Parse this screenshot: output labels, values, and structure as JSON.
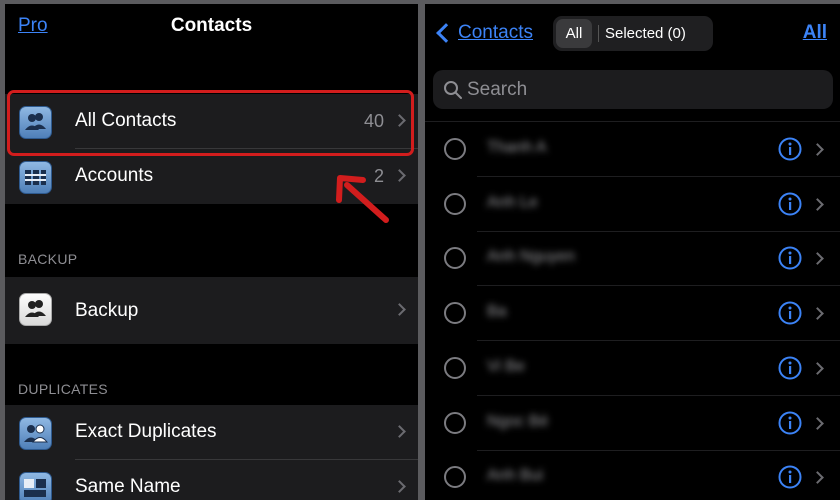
{
  "left": {
    "nav": {
      "back_label": "Pro",
      "title": "Contacts"
    },
    "group1": [
      {
        "label": "All Contacts",
        "count": "40",
        "icon": "contacts-group-icon"
      },
      {
        "label": "Accounts",
        "count": "2",
        "icon": "address-book-icon"
      }
    ],
    "backup_header": "BACKUP",
    "backup": {
      "label": "Backup",
      "icon": "backup-people-icon"
    },
    "duplicates_header": "DUPLICATES",
    "duplicates": [
      {
        "label": "Exact Duplicates",
        "icon": "duplicate-people-icon"
      },
      {
        "label": "Same Name",
        "icon": "name-card-icon"
      }
    ]
  },
  "right": {
    "nav": {
      "back_label": "Contacts",
      "seg_all": "All",
      "seg_selected": "Selected (0)",
      "all_label": "All"
    },
    "search_placeholder": "Search",
    "contacts": [
      "Thanh A",
      "Anh Le",
      "Anh Nguyen",
      "Ba",
      "Vi Be",
      "Ngoc Bé",
      "Anh Bui"
    ]
  },
  "colors": {
    "accent": "#3c83f6",
    "highlight": "#d21d1d",
    "background": "#000000",
    "row_bg": "#1c1c1e"
  }
}
